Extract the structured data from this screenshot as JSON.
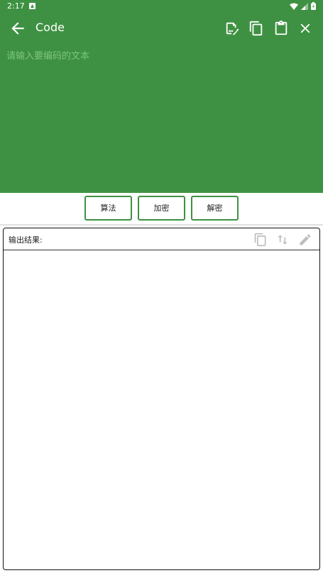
{
  "status_bar": {
    "time": "2:17",
    "icons": [
      "app-notification-icon",
      "wifi-icon",
      "signal-icon",
      "battery-icon"
    ]
  },
  "app_bar": {
    "title": "Code",
    "back_icon": "arrow-back-icon",
    "actions": [
      "edit-file-icon",
      "copy-icon",
      "paste-icon",
      "close-icon"
    ]
  },
  "input": {
    "placeholder": "请输入要编码的文本",
    "value": ""
  },
  "buttons": {
    "algorithm": "算法",
    "encrypt": "加密",
    "decrypt": "解密"
  },
  "output": {
    "label": "输出结果:",
    "value": "",
    "actions": [
      "copy-icon",
      "swap-icon",
      "edit-icon"
    ]
  },
  "colors": {
    "primary": "#3e9142",
    "placeholder": "#7cc57f",
    "disabled_icon": "#bdbdbd"
  }
}
